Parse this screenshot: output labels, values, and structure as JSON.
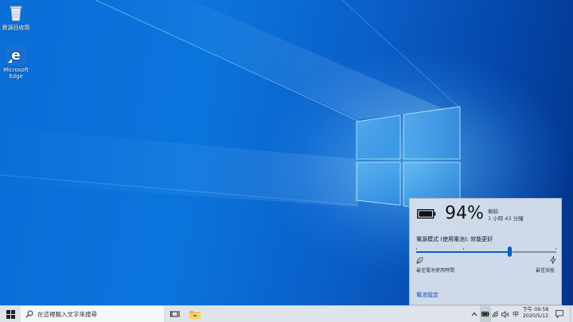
{
  "desktop": {
    "icons": [
      {
        "label": "資源回收筒",
        "icon": "recycle-bin-icon"
      },
      {
        "label": "Microsoft Edge",
        "icon": "edge-icon"
      }
    ]
  },
  "battery_flyout": {
    "percent": "94%",
    "remaining_label": "剩餘",
    "remaining_time": "1 小時 43 分鐘",
    "power_mode_label": "電源模式 (使用電池): 效能更好",
    "slider_level": 0.67,
    "min_label": "最佳電池使用時間",
    "max_label": "最佳效能",
    "settings_link": "電池設定",
    "accent_color": "#0a5fbf"
  },
  "taskbar": {
    "search_placeholder": "在這裡輸入文字來搜尋",
    "pinned": [
      {
        "name": "task-view",
        "icon": "task-view-icon"
      },
      {
        "name": "file-explorer",
        "icon": "folder-icon"
      }
    ],
    "tray": {
      "chevron": "^",
      "ime": "中",
      "time": "下午 09:58",
      "date": "2020/5/12"
    }
  }
}
